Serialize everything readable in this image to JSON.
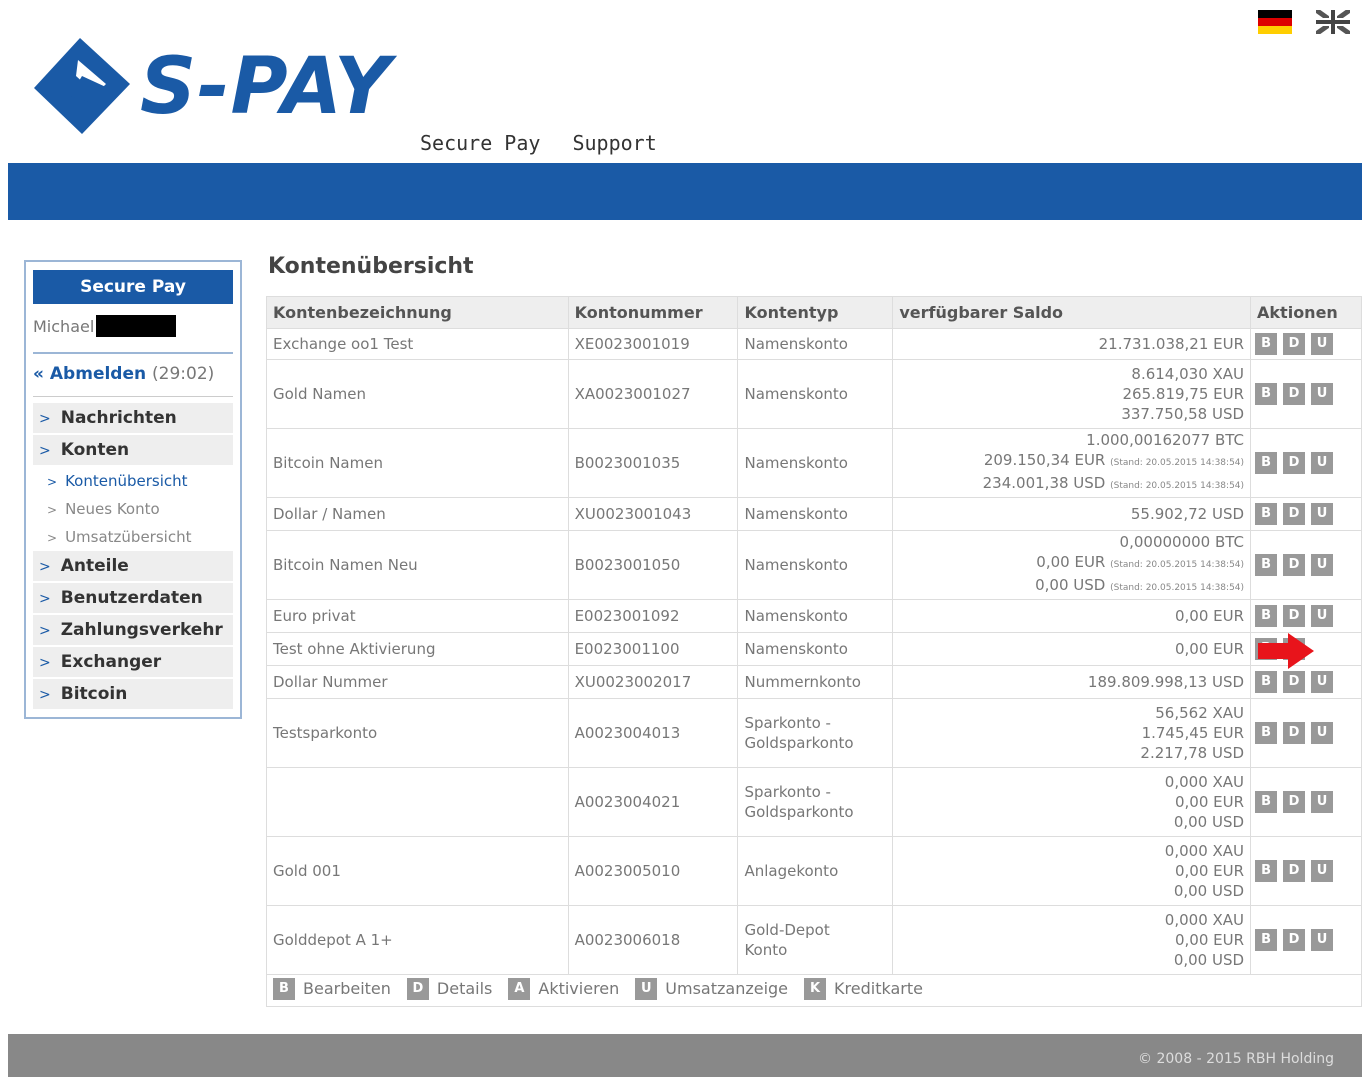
{
  "header": {
    "logo_text": "S-PAY",
    "nav": [
      "Secure Pay",
      "Support"
    ],
    "flags": [
      "flag-de",
      "flag-uk"
    ]
  },
  "sidebar": {
    "title": "Secure Pay",
    "user": "Michael",
    "logout_label": "« Abmelden",
    "logout_timer": "(29:02)",
    "items": [
      {
        "label": "Nachrichten",
        "type": "main"
      },
      {
        "label": "Konten",
        "type": "main"
      },
      {
        "label": "Kontenübersicht",
        "type": "sub",
        "active": true
      },
      {
        "label": "Neues Konto",
        "type": "sub"
      },
      {
        "label": "Umsatzübersicht",
        "type": "sub"
      },
      {
        "label": "Anteile",
        "type": "main"
      },
      {
        "label": "Benutzerdaten",
        "type": "main"
      },
      {
        "label": "Zahlungsverkehr",
        "type": "main"
      },
      {
        "label": "Exchanger",
        "type": "main"
      },
      {
        "label": "Bitcoin",
        "type": "main"
      }
    ]
  },
  "main": {
    "title": "Kontenübersicht",
    "columns": [
      "Kontenbezeichnung",
      "Kontonummer",
      "Kontentyp",
      "verfügbarer Saldo",
      "Aktionen"
    ],
    "rows": [
      {
        "name": "Exchange oo1 Test",
        "number": "XE0023001019",
        "type": [
          "Namenskonto"
        ],
        "saldo": [
          {
            "v": "21.731.038,21 EUR"
          }
        ],
        "actions": [
          "B",
          "D",
          "U"
        ],
        "h": 31
      },
      {
        "name": "Gold Namen",
        "number": "XA0023001027",
        "type": [
          "Namenskonto"
        ],
        "saldo": [
          {
            "v": "8.614,030 XAU"
          },
          {
            "v": "265.819,75 EUR"
          },
          {
            "v": "337.750,58 USD"
          }
        ],
        "actions": [
          "B",
          "D",
          "U"
        ],
        "h": 69
      },
      {
        "name": "Bitcoin Namen",
        "number": "B0023001035",
        "type": [
          "Namenskonto"
        ],
        "saldo": [
          {
            "v": "1.000,00162077 BTC"
          },
          {
            "v": "209.150,34 EUR",
            "stand": "(Stand: 20.05.2015 14:38:54)"
          },
          {
            "v": "234.001,38 USD",
            "stand": "(Stand: 20.05.2015 14:38:54)"
          }
        ],
        "actions": [
          "B",
          "D",
          "U"
        ],
        "h": 69
      },
      {
        "name": "Dollar / Namen",
        "number": "XU0023001043",
        "type": [
          "Namenskonto"
        ],
        "saldo": [
          {
            "v": "55.902,72 USD"
          }
        ],
        "actions": [
          "B",
          "D",
          "U"
        ],
        "h": 33
      },
      {
        "name": "Bitcoin Namen Neu",
        "number": "B0023001050",
        "type": [
          "Namenskonto"
        ],
        "saldo": [
          {
            "v": "0,00000000 BTC"
          },
          {
            "v": "0,00 EUR",
            "stand": "(Stand: 20.05.2015 14:38:54)"
          },
          {
            "v": "0,00 USD",
            "stand": "(Stand: 20.05.2015 14:38:54)"
          }
        ],
        "actions": [
          "B",
          "D",
          "U"
        ],
        "h": 69
      },
      {
        "name": "Euro privat",
        "number": "E0023001092",
        "type": [
          "Namenskonto"
        ],
        "saldo": [
          {
            "v": "0,00 EUR"
          }
        ],
        "actions": [
          "B",
          "D",
          "U"
        ],
        "h": 33
      },
      {
        "name": "Test ohne Aktivierung",
        "number": "E0023001100",
        "type": [
          "Namenskonto"
        ],
        "saldo": [
          {
            "v": "0,00 EUR"
          }
        ],
        "actions": [
          "B",
          "A"
        ],
        "h": 33
      },
      {
        "name": "Dollar Nummer",
        "number": "XU0023002017",
        "type": [
          "Nummernkonto"
        ],
        "saldo": [
          {
            "v": "189.809.998,13 USD"
          }
        ],
        "actions": [
          "B",
          "D",
          "U"
        ],
        "h": 33
      },
      {
        "name": "Testsparkonto",
        "number": "A0023004013",
        "type": [
          "Sparkonto -",
          "Goldsparkonto"
        ],
        "saldo": [
          {
            "v": "56,562 XAU"
          },
          {
            "v": "1.745,45 EUR"
          },
          {
            "v": "2.217,78 USD"
          }
        ],
        "actions": [
          "B",
          "D",
          "U"
        ],
        "h": 69
      },
      {
        "name": "",
        "number": "A0023004021",
        "type": [
          "Sparkonto -",
          "Goldsparkonto"
        ],
        "saldo": [
          {
            "v": "0,000 XAU"
          },
          {
            "v": "0,00 EUR"
          },
          {
            "v": "0,00 USD"
          }
        ],
        "actions": [
          "B",
          "D",
          "U"
        ],
        "h": 69
      },
      {
        "name": "Gold 001",
        "number": "A0023005010",
        "type": [
          "Anlagekonto"
        ],
        "saldo": [
          {
            "v": "0,000 XAU"
          },
          {
            "v": "0,00 EUR"
          },
          {
            "v": "0,00 USD"
          }
        ],
        "actions": [
          "B",
          "D",
          "U"
        ],
        "h": 69
      },
      {
        "name": "Golddepot A 1+",
        "number": "A0023006018",
        "type": [
          "Gold-Depot",
          "Konto"
        ],
        "saldo": [
          {
            "v": "0,000 XAU"
          },
          {
            "v": "0,00 EUR"
          },
          {
            "v": "0,00 USD"
          }
        ],
        "actions": [
          "B",
          "D",
          "U"
        ],
        "h": 69
      }
    ],
    "legend": [
      {
        "key": "B",
        "label": "Bearbeiten"
      },
      {
        "key": "D",
        "label": "Details"
      },
      {
        "key": "A",
        "label": "Aktivieren"
      },
      {
        "key": "U",
        "label": "Umsatzanzeige"
      },
      {
        "key": "K",
        "label": "Kreditkarte"
      }
    ]
  },
  "footer": {
    "text": "© 2008 - 2015 RBH Holding"
  },
  "colors": {
    "brand_blue": "#1a5aa6",
    "action_grey": "#999999",
    "arrow_red": "#e8141b"
  }
}
